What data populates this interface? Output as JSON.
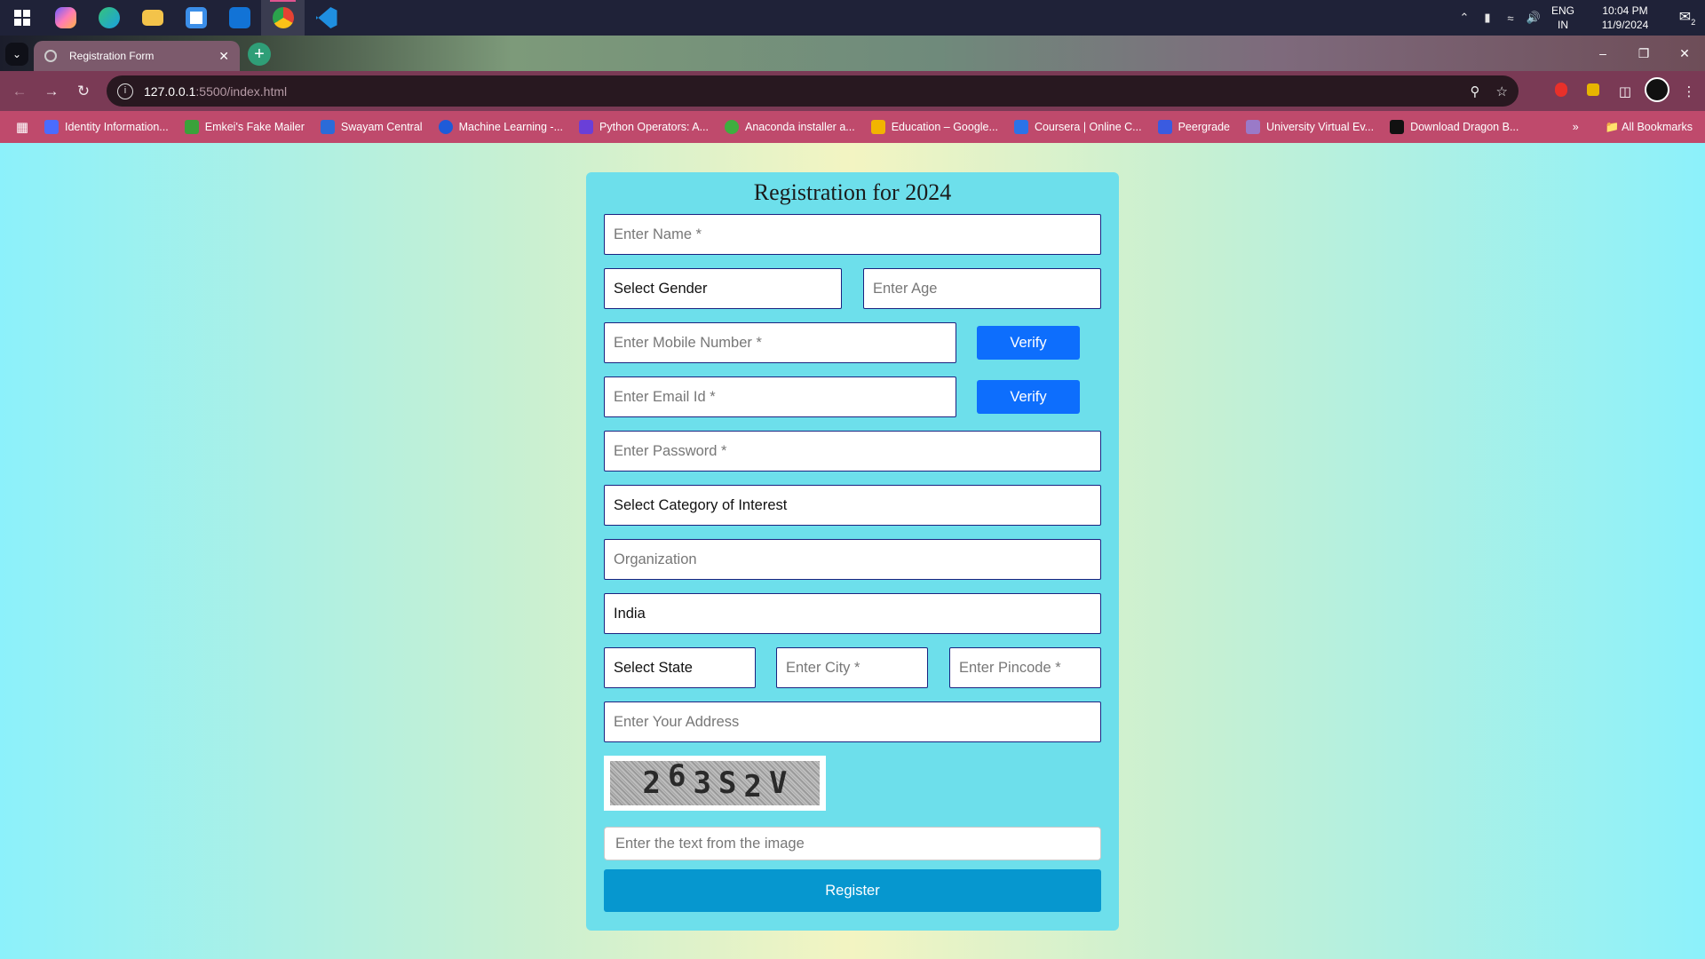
{
  "taskbar": {
    "apps": [
      {
        "name": "start-icon",
        "color": "#ffffff"
      },
      {
        "name": "copilot-icon",
        "color": "#6b5cff"
      },
      {
        "name": "edge-icon",
        "color": "#1aa0e0"
      },
      {
        "name": "file-explorer-icon",
        "color": "#f3c34a"
      },
      {
        "name": "microsoft-store-icon",
        "color": "#3b8ee8"
      },
      {
        "name": "outlook-icon",
        "color": "#1273d6"
      },
      {
        "name": "chrome-icon",
        "color": "#e64233"
      },
      {
        "name": "vscode-icon",
        "color": "#1f8fe0"
      }
    ],
    "tray": {
      "lang_line1": "ENG",
      "lang_line2": "IN",
      "time": "10:04 PM",
      "date": "11/9/2024",
      "notif_count": "2"
    }
  },
  "browser": {
    "tab_title": "Registration Form",
    "url_host": "127.0.0.1",
    "url_path": ":5500/index.html",
    "bookmarks": [
      {
        "label": "Identity Information...",
        "color": "#4a6cff"
      },
      {
        "label": "Emkei's Fake Mailer",
        "color": "#3aa23a"
      },
      {
        "label": "Swayam Central",
        "color": "#2b6bd8"
      },
      {
        "label": "Machine Learning -...",
        "color": "#1e5bd8"
      },
      {
        "label": "Python Operators: A...",
        "color": "#6a3fd8"
      },
      {
        "label": "Anaconda installer a...",
        "color": "#3fae3f"
      },
      {
        "label": "Education – Google...",
        "color": "#f2b400"
      },
      {
        "label": "Coursera | Online C...",
        "color": "#2a73e8"
      },
      {
        "label": "Peergrade",
        "color": "#3a5be0"
      },
      {
        "label": "University Virtual Ev...",
        "color": "#9a7ac8"
      },
      {
        "label": "Download Dragon B...",
        "color": "#111111"
      }
    ],
    "all_bookmarks": "All Bookmarks"
  },
  "form": {
    "title": "Registration for 2024",
    "name_placeholder": "Enter Name *",
    "gender_select": "Select Gender",
    "age_placeholder": "Enter Age",
    "mobile_placeholder": "Enter Mobile Number *",
    "verify_mobile": "Verify",
    "email_placeholder": "Enter Email Id *",
    "verify_email": "Verify",
    "password_placeholder": "Enter Password *",
    "category_select": "Select Category of Interest",
    "organization_placeholder": "Organization",
    "country_value": "India",
    "state_select": "Select State",
    "city_placeholder": "Enter City *",
    "pincode_placeholder": "Enter Pincode *",
    "address_placeholder": "Enter Your Address",
    "captcha_text": [
      "2",
      "6",
      "3",
      "S",
      "2",
      "V"
    ],
    "captcha_placeholder": "Enter the text from the image",
    "register_label": "Register"
  }
}
